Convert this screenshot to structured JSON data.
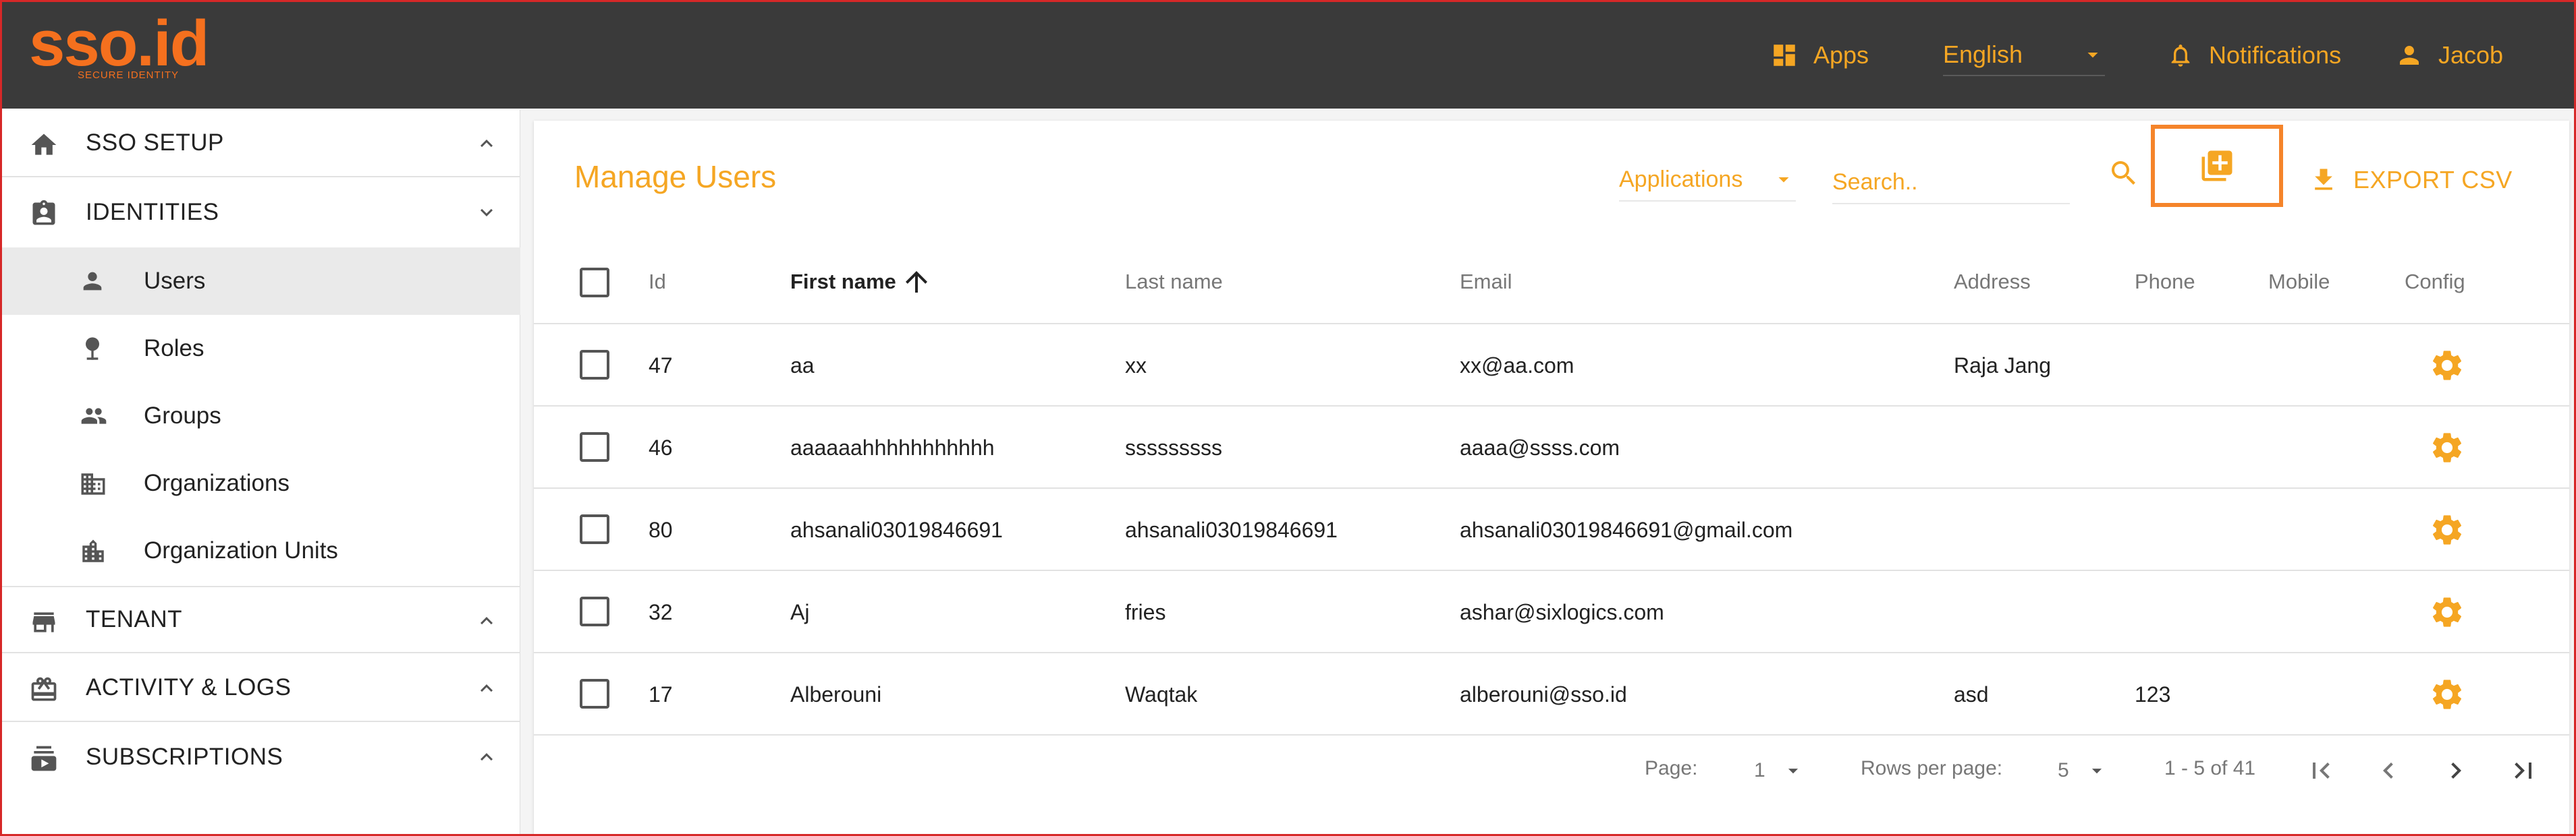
{
  "brand": {
    "logo_text": "sso.id",
    "logo_tagline": "SECURE IDENTITY",
    "accent": "#f5a623",
    "header_bg": "#3a3a3a"
  },
  "header": {
    "apps_label": "Apps",
    "language": "English",
    "notifications_label": "Notifications",
    "user_name": "Jacob"
  },
  "sidebar": {
    "sections": [
      {
        "label": "SSO SETUP",
        "icon": "home-icon",
        "expanded": false
      },
      {
        "label": "IDENTITIES",
        "icon": "badge-icon",
        "expanded": true
      },
      {
        "label": "TENANT",
        "icon": "store-icon",
        "expanded": false
      },
      {
        "label": "ACTIVITY & LOGS",
        "icon": "activity-icon",
        "expanded": false
      },
      {
        "label": "SUBSCRIPTIONS",
        "icon": "subscriptions-icon",
        "expanded": false
      }
    ],
    "items": [
      {
        "label": "Users",
        "icon": "person-icon",
        "active": true
      },
      {
        "label": "Roles",
        "icon": "role-pin-icon",
        "active": false
      },
      {
        "label": "Groups",
        "icon": "group-icon",
        "active": false
      },
      {
        "label": "Organizations",
        "icon": "building-icon",
        "active": false
      },
      {
        "label": "Organization Units",
        "icon": "organization-unit-icon",
        "active": false
      }
    ]
  },
  "main": {
    "title": "Manage Users",
    "applications_filter": "Applications",
    "search_placeholder": "Search..",
    "export_label": "EXPORT CSV",
    "columns": {
      "id": "Id",
      "first_name": "First name",
      "last_name": "Last name",
      "email": "Email",
      "address": "Address",
      "phone": "Phone",
      "mobile": "Mobile",
      "config": "Config"
    },
    "sort": {
      "column": "First name",
      "direction": "ascending"
    },
    "rows": [
      {
        "id": "47",
        "first_name": "aa",
        "last_name": "xx",
        "email": "xx@aa.com",
        "address": "Raja Jang",
        "phone": "",
        "mobile": ""
      },
      {
        "id": "46",
        "first_name": "aaaaaahhhhhhhhhhh",
        "last_name": "sssssssss",
        "email": "aaaa@ssss.com",
        "address": "",
        "phone": "",
        "mobile": ""
      },
      {
        "id": "80",
        "first_name": "ahsanali03019846691",
        "last_name": "ahsanali03019846691",
        "email": "ahsanali03019846691@gmail.com",
        "address": "",
        "phone": "",
        "mobile": ""
      },
      {
        "id": "32",
        "first_name": "Aj",
        "last_name": "fries",
        "email": "ashar@sixlogics.com",
        "address": "",
        "phone": "",
        "mobile": ""
      },
      {
        "id": "17",
        "first_name": "Alberouni",
        "last_name": "Waqtak",
        "email": "alberouni@sso.id",
        "address": "asd",
        "phone": "123",
        "mobile": ""
      }
    ],
    "pagination": {
      "page_label": "Page:",
      "page": "1",
      "rows_label": "Rows per page:",
      "rows_per_page": "5",
      "range": "1 - 5 of 41"
    }
  }
}
